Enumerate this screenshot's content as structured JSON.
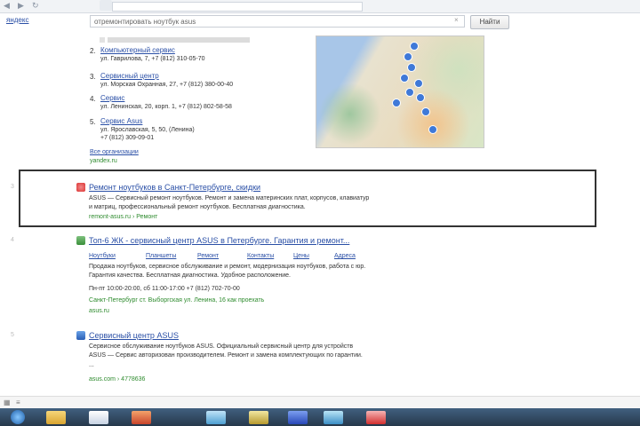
{
  "search": {
    "logo_link": "яндекс",
    "query": "отремонтировать ноутбук asus",
    "clear": "×",
    "button": "Найти"
  },
  "places": [
    {
      "num": "2.",
      "name": "Компьютерный сервис",
      "addr": "ул. Гаврилова, 7, +7 (812) 310-05-70"
    },
    {
      "num": "3.",
      "name": "Сервисный центр",
      "addr": "ул. Морская Охранная, 27, +7 (812) 380-00-40"
    },
    {
      "num": "4.",
      "name": "Сервис",
      "addr": "ул. Ленинская, 20, корп. 1, +7 (812) 802-58-58"
    },
    {
      "num": "5.",
      "name": "Сервис Asus",
      "addr1": "ул. Ярославская, 5, 50, (Ленина)",
      "addr2": "+7 (812) 309-09-01"
    }
  ],
  "more_places": "Все организации",
  "more_places_url": "yandex.ru",
  "results": [
    {
      "idx": "3",
      "title": "Ремонт ноутбуков в Санкт-Петербурге, скидки",
      "snippet1": "ASUS — Сервисный ремонт ноутбуков. Ремонт и замена материнских плат, корпусов, клавиатур",
      "snippet2": "и матриц, профессиональный ремонт ноутбуков. Бесплатная диагностика.",
      "url": "remont-asus.ru › Ремонт"
    },
    {
      "idx": "4",
      "title": "Топ-6 ЖК - сервисный центр ASUS в Петербурге. Гарантия и ремонт...",
      "sitelinks": [
        "Ноутбуки",
        "Планшеты",
        "Ремонт",
        "Контакты",
        "Цены",
        "Адреса"
      ],
      "snippet1": "Продажа ноутбуков, сервисное обслуживание и ремонт, модернизация ноутбуков, работа с юр.",
      "snippet2": "Гарантия качества. Бесплатная диагностика. Удобное расположение.",
      "snippet3": "Пн-пт 10:00-20:00, сб 11:00-17:00   +7 (812) 702-70-00",
      "url": "Санкт-Петербург  ст. Выборгская  ул. Ленина, 16  как проехать",
      "url2": "asus.ru"
    },
    {
      "idx": "5",
      "title": "Сервисный центр ASUS",
      "snippet1": "Сервисное обслуживание ноутбуков ASUS. Официальный сервисный центр для устройств",
      "snippet2": "ASUS — Сервис авторизован производителем. Ремонт и замена комплектующих по гарантии.",
      "snippet3": "...",
      "url": "asus.com › 4778636"
    }
  ],
  "colors": {
    "link": "#2a4fa6",
    "url_green": "#2e8b2e",
    "highlight_border": "#333333",
    "taskbar": "#26384b"
  }
}
